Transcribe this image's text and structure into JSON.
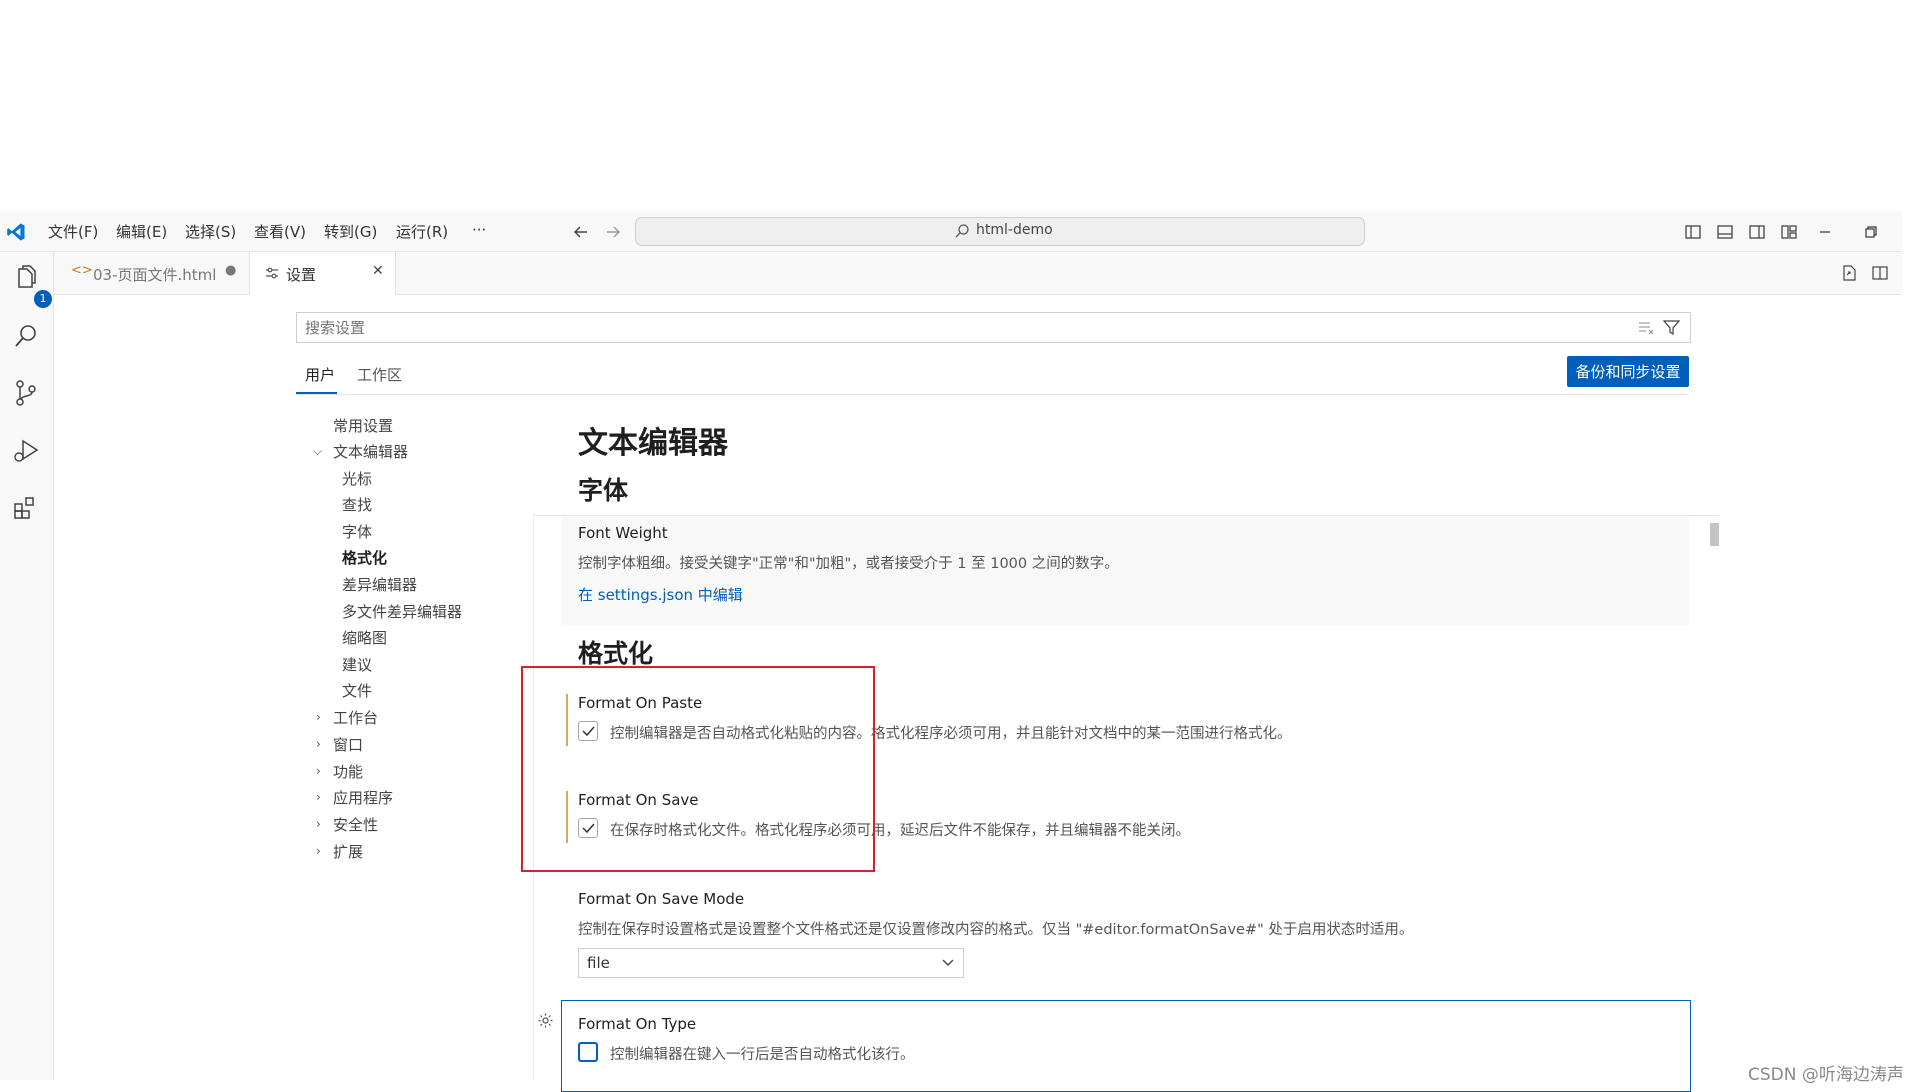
{
  "menu": [
    "文件(F)",
    "编辑(E)",
    "选择(S)",
    "查看(V)",
    "转到(G)",
    "运行(R)",
    "···"
  ],
  "command_center": "html-demo",
  "activity": {
    "explorer_badge": "1"
  },
  "tabs": [
    {
      "label": "03-页面文件.html",
      "dirty": "●"
    },
    {
      "label": "设置",
      "close": "✕"
    }
  ],
  "search": {
    "placeholder": "搜索设置"
  },
  "scope_tabs": [
    "用户",
    "工作区"
  ],
  "sync_button": "备份和同步设置",
  "toc": {
    "common": "常用设置",
    "text_editor": "文本编辑器",
    "text_editor_children": [
      "光标",
      "查找",
      "字体",
      "格式化",
      "差异编辑器",
      "多文件差异编辑器",
      "缩略图",
      "建议",
      "文件"
    ],
    "collapsed": [
      "工作台",
      "窗口",
      "功能",
      "应用程序",
      "安全性",
      "扩展"
    ]
  },
  "content": {
    "title": "文本编辑器",
    "font_section": "字体",
    "font_weight": {
      "title": "Font Weight",
      "description": "控制字体粗细。接受关键字\"正常\"和\"加粗\"，或者接受介于 1 至 1000 之间的数字。",
      "link": "在 settings.json 中编辑"
    },
    "format_section": "格式化",
    "format_on_paste": {
      "title": "Format On Paste",
      "description": "控制编辑器是否自动格式化粘贴的内容。格式化程序必须可用，并且能针对文档中的某一范围进行格式化。",
      "checked": true
    },
    "format_on_save": {
      "title": "Format On Save",
      "description": "在保存时格式化文件。格式化程序必须可用，延迟后文件不能保存，并且编辑器不能关闭。",
      "checked": true
    },
    "format_on_save_mode": {
      "title": "Format On Save Mode",
      "description": "控制在保存时设置格式是设置整个文件格式还是仅设置修改内容的格式。仅当 \"#editor.formatOnSave#\" 处于启用状态时适用。",
      "value": "file"
    },
    "format_on_type": {
      "title": "Format On Type",
      "description": "控制编辑器在键入一行后是否自动格式化该行。",
      "checked": false
    }
  },
  "watermark": "CSDN @听海边涛声",
  "colors": {
    "accent": "#005fb8",
    "highlight_box": "#d6202c",
    "modified_bar": "#d6a85c"
  }
}
